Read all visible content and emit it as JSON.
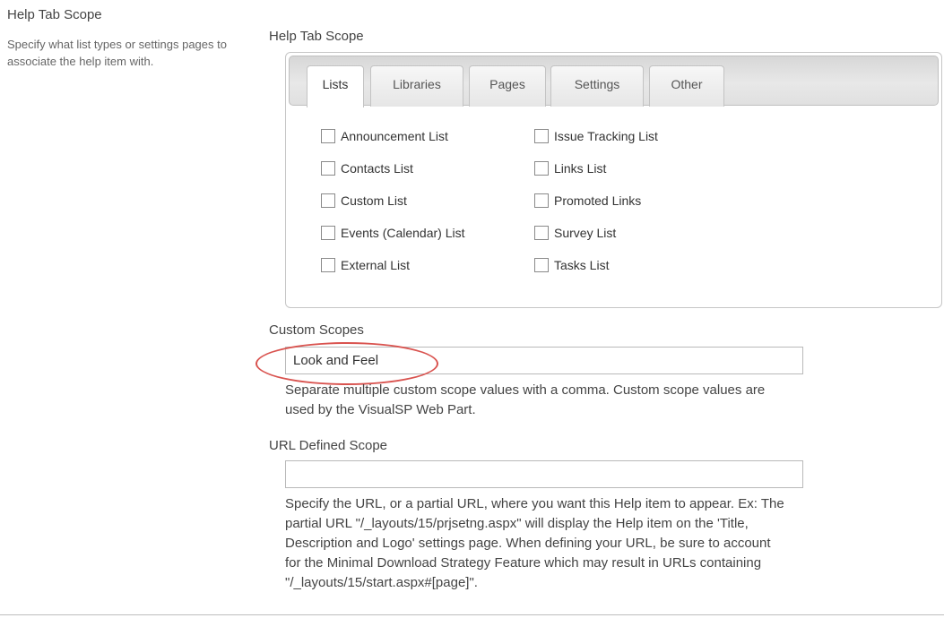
{
  "left": {
    "title": "Help Tab Scope",
    "description": "Specify what list types or settings pages to associate the help item with."
  },
  "scope": {
    "label": "Help Tab Scope",
    "tabs": [
      {
        "label": "Lists",
        "active": true
      },
      {
        "label": "Libraries",
        "active": false
      },
      {
        "label": "Pages",
        "active": false
      },
      {
        "label": "Settings",
        "active": false
      },
      {
        "label": "Other",
        "active": false
      }
    ],
    "checkboxes": [
      {
        "label": "Announcement List",
        "checked": false
      },
      {
        "label": "Contacts List",
        "checked": false
      },
      {
        "label": "Custom List",
        "checked": false
      },
      {
        "label": "Events (Calendar) List",
        "checked": false
      },
      {
        "label": "External List",
        "checked": false
      },
      {
        "label": "Issue Tracking List",
        "checked": false
      },
      {
        "label": "Links List",
        "checked": false
      },
      {
        "label": "Promoted Links",
        "checked": false
      },
      {
        "label": "Survey List",
        "checked": false
      },
      {
        "label": "Tasks List",
        "checked": false
      }
    ]
  },
  "custom_scopes": {
    "label": "Custom Scopes",
    "value": "Look and Feel",
    "help_lines": [
      "Separate multiple custom scope values with a comma. Custom scope values are",
      "used by the VisualSP Web Part."
    ]
  },
  "url_scope": {
    "label": "URL Defined Scope",
    "value": "",
    "help_lines": [
      "Specify the URL, or a partial URL, where you want this Help item to appear. Ex: The",
      "partial URL \"/_layouts/15/prjsetng.aspx\" will display the Help item on the 'Title,",
      "Description and Logo' settings page. When defining your URL, be sure to account",
      "for the Minimal Download Strategy Feature which may result in URLs containing",
      "\"/_layouts/15/start.aspx#[page]\"."
    ]
  },
  "colors": {
    "highlight": "#d9534f"
  }
}
